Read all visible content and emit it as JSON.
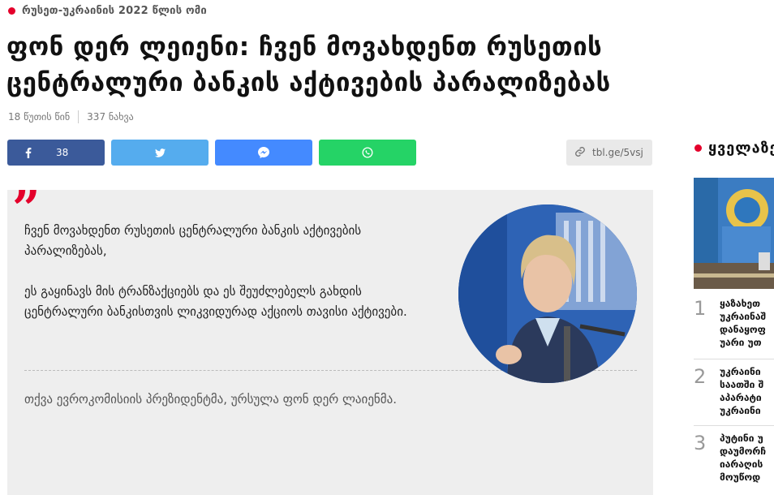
{
  "article": {
    "category": "რუსეთ-უკრაინის 2022 წლის ომი",
    "headline_line1": "ფონ დერ ლეიენი: ჩვენ მოვახდენთ რუსეთის",
    "headline_line2": "ცენტრალური ბანკის აქტივების პარალიზებას",
    "time_ago": "18 წუთის წინ",
    "views": "337 ნახვა"
  },
  "share": {
    "facebook_count": "38",
    "short_link": "tbl.ge/5vsj",
    "icons": [
      "facebook-icon",
      "twitter-icon",
      "messenger-icon",
      "whatsapp-icon",
      "link-icon"
    ]
  },
  "quote": {
    "mark": "”",
    "paragraph1": "ჩვენ მოვახდენთ რუსეთის ცენტრალური ბანკის აქტივების პარალიზებას,",
    "paragraph2": "ეს გაყინავს მის ტრანზაქციებს და ეს შეუძლებელს გახდის ცენტრალური ბანკისთვის ლიკვიდურად აქციოს თავისი აქტივები.",
    "author": "თქვა ევროკომისიის პრეზიდენტმა, ურსულა ფონ დერ ლაიენმა."
  },
  "sidebar": {
    "title": "ყველაზე",
    "items": [
      {
        "number": "1",
        "lines": [
          "ყაზახეთ",
          "უკრაინაშ",
          "დანაყოფ",
          "უარი უთ"
        ]
      },
      {
        "number": "2",
        "lines": [
          "უკრაინი",
          "საათში შ",
          "აპარატი",
          "უკრაინი"
        ]
      },
      {
        "number": "3",
        "lines": [
          "პუტინი უ",
          "დაუმორჩ",
          "იარაღის",
          "მოუწოდ"
        ]
      }
    ]
  },
  "colors": {
    "accent": "#e4002b",
    "facebook": "#3b5a9a",
    "twitter": "#55acee",
    "messenger": "#448aff",
    "whatsapp": "#25d366"
  }
}
